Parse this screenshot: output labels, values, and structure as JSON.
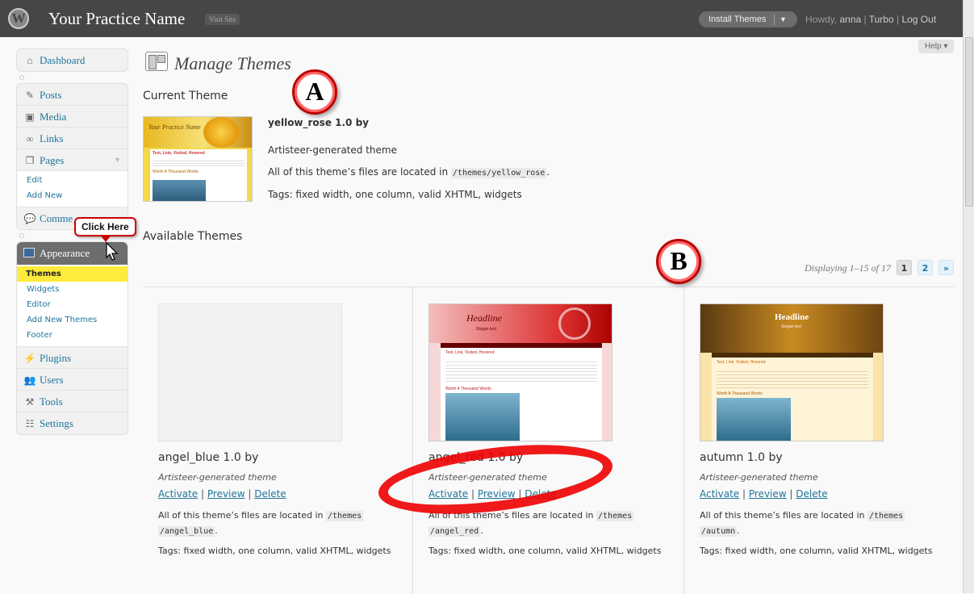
{
  "topbar": {
    "logo_letter": "W",
    "site_name": "Your Practice Name",
    "visit_site": "Visit Site",
    "install_button": "Install Themes",
    "howdy": "Howdy,",
    "user": "anna",
    "turbo": "Turbo",
    "logout": "Log Out"
  },
  "help": "Help",
  "sidebar": {
    "dashboard": "Dashboard",
    "posts": "Posts",
    "media": "Media",
    "links": "Links",
    "pages": "Pages",
    "pages_sub": [
      "Edit",
      "Add New"
    ],
    "comments": "Comme",
    "appearance": "Appearance",
    "appearance_sub": [
      "Themes",
      "Widgets",
      "Editor",
      "Add New Themes",
      "Footer"
    ],
    "plugins": "Plugins",
    "users": "Users",
    "tools": "Tools",
    "settings": "Settings"
  },
  "callout": "Click Here",
  "markers": {
    "a": "A",
    "b": "B"
  },
  "main": {
    "title": "Manage Themes",
    "current_heading": "Current Theme",
    "current": {
      "name": "yellow_rose 1.0 by",
      "description": "Artisteer-generated theme",
      "files_prefix": "All of this theme’s files are located in",
      "path": "/themes/yellow_rose",
      "files_suffix": ".",
      "tags": "Tags: fixed width, one column, valid XHTML, widgets"
    },
    "available_heading": "Available Themes",
    "pager": {
      "text": "Displaying 1–15 of 17",
      "page1": "1",
      "page2": "2",
      "next": "»"
    },
    "themes": [
      {
        "name": "angel_blue 1.0 by",
        "desc": "Artisteer-generated theme",
        "activate": "Activate",
        "preview": "Preview",
        "delete": "Delete",
        "files_prefix": "All of this theme’s files are located in",
        "path1": "/themes",
        "path2": "/angel_blue",
        "files_suffix": ".",
        "tags": "Tags: fixed width, one column, valid XHTML, widgets"
      },
      {
        "name": "angel_red 1.0 by",
        "desc": "Artisteer-generated theme",
        "activate": "Activate",
        "preview": "Preview",
        "delete": "Delete",
        "files_prefix": "All of this theme’s files are located in",
        "path1": "/themes",
        "path2": "/angel_red",
        "files_suffix": ".",
        "tags": "Tags: fixed width, one column, valid XHTML, widgets"
      },
      {
        "name": "autumn 1.0 by",
        "desc": "Artisteer-generated theme",
        "activate": "Activate",
        "preview": "Preview",
        "delete": "Delete",
        "files_prefix": "All of this theme’s files are located in",
        "path1": "/themes",
        "path2": "/autumn",
        "files_suffix": ".",
        "tags": "Tags: fixed width, one column, valid XHTML, widgets"
      }
    ],
    "thumbs": {
      "red_headline": "Headline",
      "red_slogan": "Slogan text",
      "red_sub": "Text, Link, Visited, Hovered",
      "red_worth": "Worth A Thousand Words",
      "autumn_headline": "Headline",
      "autumn_slogan": "Slogan text",
      "autumn_sub": "Text, Link, Visited, Hovered",
      "autumn_worth": "Worth A Thousand Words",
      "yr_title": "Your Practice Name",
      "yr_sub": "Text, Link, Visited, Hovered",
      "yr_worth": "Worth A Thousand Words"
    }
  }
}
